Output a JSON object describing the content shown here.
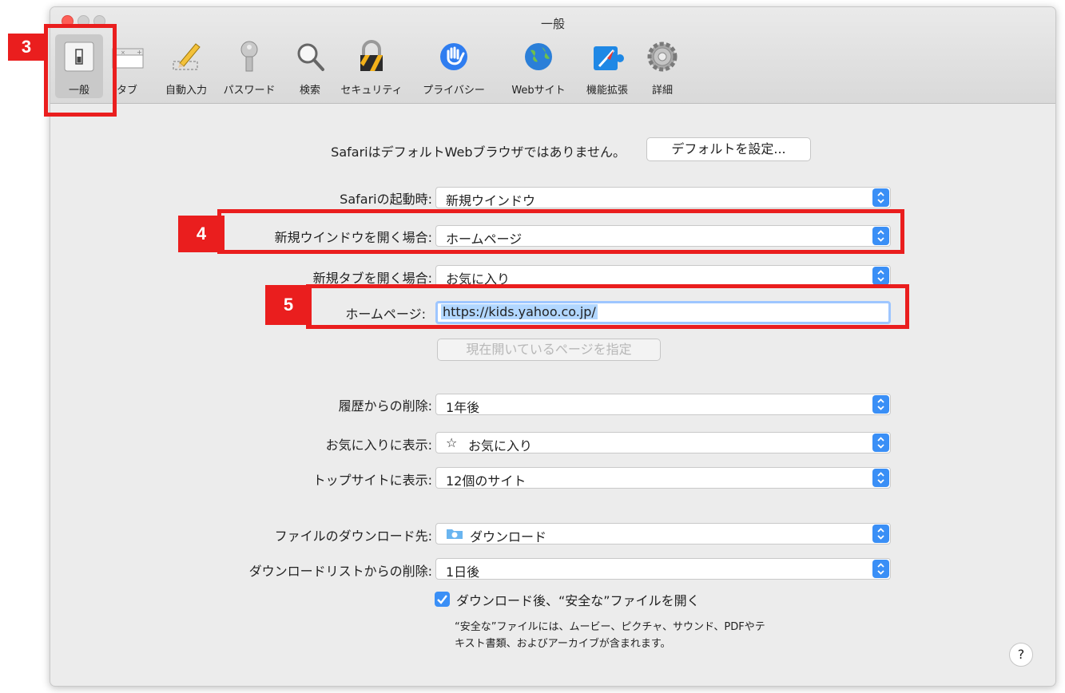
{
  "window": {
    "title": "一般"
  },
  "toolbar": {
    "items": [
      {
        "label": "一般",
        "icon": "general-switch-icon",
        "selected": true
      },
      {
        "label": "タブ",
        "icon": "tabs-icon"
      },
      {
        "label": "自動入力",
        "icon": "pencil-icon"
      },
      {
        "label": "パスワード",
        "icon": "key-icon"
      },
      {
        "label": "検索",
        "icon": "magnifier-icon"
      },
      {
        "label": "セキュリティ",
        "icon": "lock-icon"
      },
      {
        "label": "プライバシー",
        "icon": "hand-icon"
      },
      {
        "label": "Webサイト",
        "icon": "globe-icon"
      },
      {
        "label": "機能拡張",
        "icon": "puzzle-compass-icon"
      },
      {
        "label": "詳細",
        "icon": "gear-icon"
      }
    ]
  },
  "default_browser": {
    "message": "SafariはデフォルトWebブラウザではありません。",
    "button": "デフォルトを設定..."
  },
  "settings": {
    "launch": {
      "label": "Safariの起動時:",
      "value": "新規ウインドウ"
    },
    "new_window": {
      "label": "新規ウインドウを開く場合:",
      "value": "ホームページ"
    },
    "new_tab": {
      "label": "新規タブを開く場合:",
      "value": "お気に入り"
    },
    "homepage": {
      "label": "ホームページ:",
      "value": "https://kids.yahoo.co.jp/"
    },
    "set_current_page": "現在開いているページを指定",
    "remove_history": {
      "label": "履歴からの削除:",
      "value": "1年後"
    },
    "favorites_show": {
      "label": "お気に入りに表示:",
      "value": "お気に入り",
      "icon": "star-icon"
    },
    "topsites_show": {
      "label": "トップサイトに表示:",
      "value": "12個のサイト"
    },
    "download_location": {
      "label": "ファイルのダウンロード先:",
      "value": "ダウンロード",
      "icon": "download-folder-icon"
    },
    "remove_download_list": {
      "label": "ダウンロードリストからの削除:",
      "value": "1日後"
    },
    "open_safe_files": {
      "label": "ダウンロード後、“安全な”ファイルを開く",
      "checked": true
    },
    "safe_files_note": "“安全な”ファイルには、ムービー、ピクチャ、サウンド、PDFやテキスト書類、およびアーカイブが含まれます。"
  },
  "help": "?",
  "annotations": {
    "marker3": "3",
    "marker4": "4",
    "marker5": "5",
    "color": "#ea1e1e"
  },
  "colors": {
    "accent": "#3a8ff6",
    "selection": "#b2d7ff"
  }
}
